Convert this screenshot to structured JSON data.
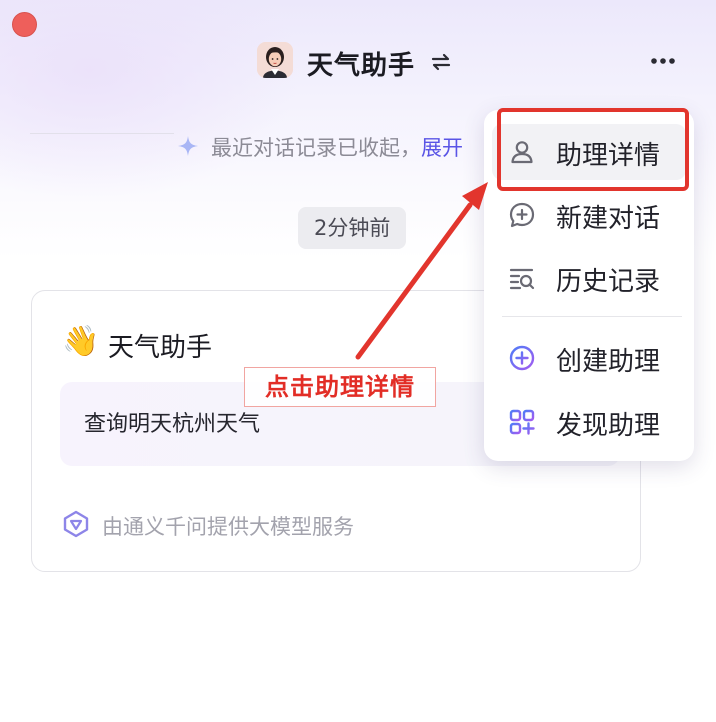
{
  "header": {
    "title": "天气助手",
    "swap_icon": "swap-icon",
    "more_icon": "more-icon"
  },
  "history": {
    "notice": "最近对话记录已收起，",
    "expand_label": "展开"
  },
  "time_pill": "2分钟前",
  "card": {
    "emoji": "👋",
    "title": "天气助手",
    "query": "查询明天杭州天气",
    "provider": "由通义千问提供大模型服务"
  },
  "menu": {
    "items": [
      {
        "label": "助理详情",
        "icon": "user-icon"
      },
      {
        "label": "新建对话",
        "icon": "chat-plus-icon"
      },
      {
        "label": "历史记录",
        "icon": "history-icon"
      },
      {
        "label": "创建助理",
        "icon": "plus-circle-icon"
      },
      {
        "label": "发现助理",
        "icon": "grid-plus-icon"
      }
    ]
  },
  "annotation": {
    "callout": "点击助理详情",
    "color": "#e2352d"
  },
  "colors": {
    "accent": "#5a55e6",
    "close": "#ee5f5b"
  }
}
